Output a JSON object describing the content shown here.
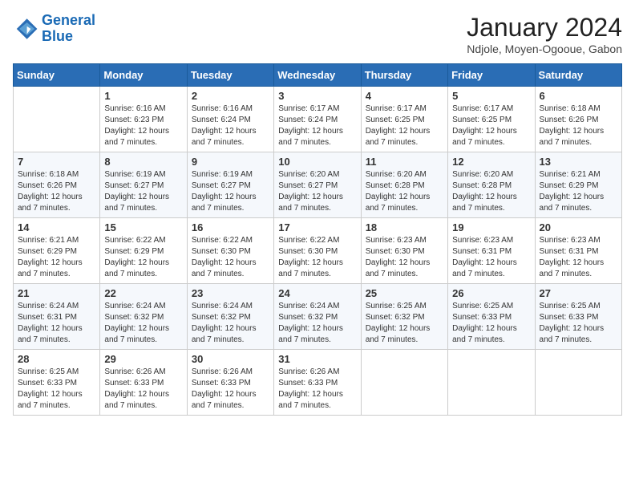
{
  "header": {
    "logo_line1": "General",
    "logo_line2": "Blue",
    "month_title": "January 2024",
    "location": "Ndjole, Moyen-Ogooue, Gabon"
  },
  "days_of_week": [
    "Sunday",
    "Monday",
    "Tuesday",
    "Wednesday",
    "Thursday",
    "Friday",
    "Saturday"
  ],
  "weeks": [
    [
      {
        "day": "",
        "info": ""
      },
      {
        "day": "1",
        "info": "Sunrise: 6:16 AM\nSunset: 6:23 PM\nDaylight: 12 hours\nand 7 minutes."
      },
      {
        "day": "2",
        "info": "Sunrise: 6:16 AM\nSunset: 6:24 PM\nDaylight: 12 hours\nand 7 minutes."
      },
      {
        "day": "3",
        "info": "Sunrise: 6:17 AM\nSunset: 6:24 PM\nDaylight: 12 hours\nand 7 minutes."
      },
      {
        "day": "4",
        "info": "Sunrise: 6:17 AM\nSunset: 6:25 PM\nDaylight: 12 hours\nand 7 minutes."
      },
      {
        "day": "5",
        "info": "Sunrise: 6:17 AM\nSunset: 6:25 PM\nDaylight: 12 hours\nand 7 minutes."
      },
      {
        "day": "6",
        "info": "Sunrise: 6:18 AM\nSunset: 6:26 PM\nDaylight: 12 hours\nand 7 minutes."
      }
    ],
    [
      {
        "day": "7",
        "info": "Sunrise: 6:18 AM\nSunset: 6:26 PM\nDaylight: 12 hours\nand 7 minutes."
      },
      {
        "day": "8",
        "info": "Sunrise: 6:19 AM\nSunset: 6:27 PM\nDaylight: 12 hours\nand 7 minutes."
      },
      {
        "day": "9",
        "info": "Sunrise: 6:19 AM\nSunset: 6:27 PM\nDaylight: 12 hours\nand 7 minutes."
      },
      {
        "day": "10",
        "info": "Sunrise: 6:20 AM\nSunset: 6:27 PM\nDaylight: 12 hours\nand 7 minutes."
      },
      {
        "day": "11",
        "info": "Sunrise: 6:20 AM\nSunset: 6:28 PM\nDaylight: 12 hours\nand 7 minutes."
      },
      {
        "day": "12",
        "info": "Sunrise: 6:20 AM\nSunset: 6:28 PM\nDaylight: 12 hours\nand 7 minutes."
      },
      {
        "day": "13",
        "info": "Sunrise: 6:21 AM\nSunset: 6:29 PM\nDaylight: 12 hours\nand 7 minutes."
      }
    ],
    [
      {
        "day": "14",
        "info": "Sunrise: 6:21 AM\nSunset: 6:29 PM\nDaylight: 12 hours\nand 7 minutes."
      },
      {
        "day": "15",
        "info": "Sunrise: 6:22 AM\nSunset: 6:29 PM\nDaylight: 12 hours\nand 7 minutes."
      },
      {
        "day": "16",
        "info": "Sunrise: 6:22 AM\nSunset: 6:30 PM\nDaylight: 12 hours\nand 7 minutes."
      },
      {
        "day": "17",
        "info": "Sunrise: 6:22 AM\nSunset: 6:30 PM\nDaylight: 12 hours\nand 7 minutes."
      },
      {
        "day": "18",
        "info": "Sunrise: 6:23 AM\nSunset: 6:30 PM\nDaylight: 12 hours\nand 7 minutes."
      },
      {
        "day": "19",
        "info": "Sunrise: 6:23 AM\nSunset: 6:31 PM\nDaylight: 12 hours\nand 7 minutes."
      },
      {
        "day": "20",
        "info": "Sunrise: 6:23 AM\nSunset: 6:31 PM\nDaylight: 12 hours\nand 7 minutes."
      }
    ],
    [
      {
        "day": "21",
        "info": "Sunrise: 6:24 AM\nSunset: 6:31 PM\nDaylight: 12 hours\nand 7 minutes."
      },
      {
        "day": "22",
        "info": "Sunrise: 6:24 AM\nSunset: 6:32 PM\nDaylight: 12 hours\nand 7 minutes."
      },
      {
        "day": "23",
        "info": "Sunrise: 6:24 AM\nSunset: 6:32 PM\nDaylight: 12 hours\nand 7 minutes."
      },
      {
        "day": "24",
        "info": "Sunrise: 6:24 AM\nSunset: 6:32 PM\nDaylight: 12 hours\nand 7 minutes."
      },
      {
        "day": "25",
        "info": "Sunrise: 6:25 AM\nSunset: 6:32 PM\nDaylight: 12 hours\nand 7 minutes."
      },
      {
        "day": "26",
        "info": "Sunrise: 6:25 AM\nSunset: 6:33 PM\nDaylight: 12 hours\nand 7 minutes."
      },
      {
        "day": "27",
        "info": "Sunrise: 6:25 AM\nSunset: 6:33 PM\nDaylight: 12 hours\nand 7 minutes."
      }
    ],
    [
      {
        "day": "28",
        "info": "Sunrise: 6:25 AM\nSunset: 6:33 PM\nDaylight: 12 hours\nand 7 minutes."
      },
      {
        "day": "29",
        "info": "Sunrise: 6:26 AM\nSunset: 6:33 PM\nDaylight: 12 hours\nand 7 minutes."
      },
      {
        "day": "30",
        "info": "Sunrise: 6:26 AM\nSunset: 6:33 PM\nDaylight: 12 hours\nand 7 minutes."
      },
      {
        "day": "31",
        "info": "Sunrise: 6:26 AM\nSunset: 6:33 PM\nDaylight: 12 hours\nand 7 minutes."
      },
      {
        "day": "",
        "info": ""
      },
      {
        "day": "",
        "info": ""
      },
      {
        "day": "",
        "info": ""
      }
    ]
  ]
}
